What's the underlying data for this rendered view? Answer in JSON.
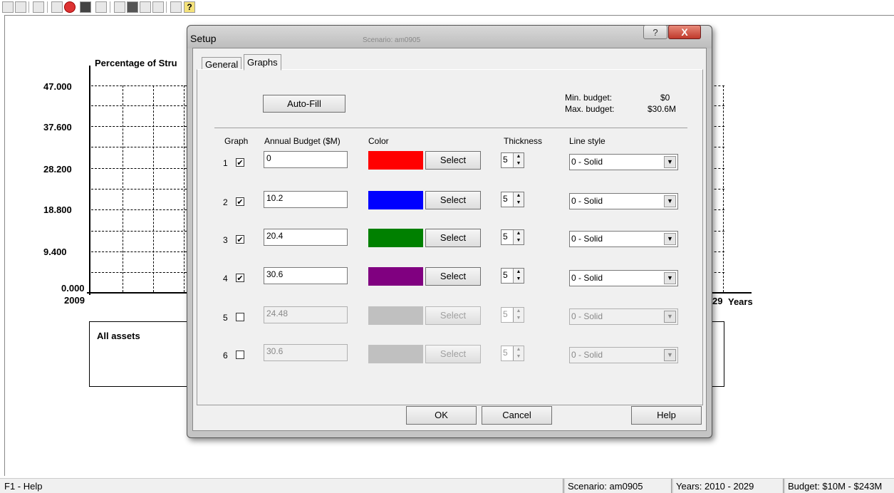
{
  "toolbar": {
    "icons": [
      "print-icon",
      "print-preview-icon",
      "export-icon",
      "open-icon",
      "close-red-icon",
      "save-icon",
      "print2-icon",
      "chart-icon",
      "fill-icon",
      "table-icon",
      "report-icon",
      "tools-icon",
      "help-icon"
    ]
  },
  "chart": {
    "title": "Percentage of Stru",
    "y_ticks": [
      "47.000",
      "37.600",
      "28.200",
      "18.800",
      "9.400",
      "0.000"
    ],
    "x_start": "2009",
    "x_end": "29",
    "x_axis_label": "Years",
    "legend_label": "All assets"
  },
  "dialog": {
    "title": "Setup",
    "bg_title": "Scenario: am0905",
    "help_glyph": "?",
    "close_glyph": "X",
    "tabs": [
      {
        "label": "General"
      },
      {
        "label": "Graphs"
      }
    ],
    "autofill_label": "Auto-Fill",
    "min_budget_label": "Min. budget:",
    "min_budget_value": "$0",
    "max_budget_label": "Max. budget:",
    "max_budget_value": "$30.6M",
    "col_graph": "Graph",
    "col_budget": "Annual Budget ($M)",
    "col_color": "Color",
    "col_thickness": "Thickness",
    "col_linestyle": "Line style",
    "rows": [
      {
        "num": "1",
        "checked": true,
        "budget": "0",
        "color": "#ff0000",
        "select": "Select",
        "thickness": "5",
        "style": "0 - Solid",
        "enabled": true
      },
      {
        "num": "2",
        "checked": true,
        "budget": "10.2",
        "color": "#0000ff",
        "select": "Select",
        "thickness": "5",
        "style": "0 - Solid",
        "enabled": true
      },
      {
        "num": "3",
        "checked": true,
        "budget": "20.4",
        "color": "#008000",
        "select": "Select",
        "thickness": "5",
        "style": "0 - Solid",
        "enabled": true
      },
      {
        "num": "4",
        "checked": true,
        "budget": "30.6",
        "color": "#800080",
        "select": "Select",
        "thickness": "5",
        "style": "0 - Solid",
        "enabled": true
      },
      {
        "num": "5",
        "checked": false,
        "budget": "24.48",
        "color": "#c0c0c0",
        "select": "Select",
        "thickness": "5",
        "style": "0 - Solid",
        "enabled": false
      },
      {
        "num": "6",
        "checked": false,
        "budget": "30.6",
        "color": "#c0c0c0",
        "select": "Select",
        "thickness": "5",
        "style": "0 - Solid",
        "enabled": false
      }
    ],
    "ok_label": "OK",
    "cancel_label": "Cancel",
    "help_label": "Help"
  },
  "status": {
    "help": "F1 - Help",
    "scenario": "Scenario: am0905",
    "years": "Years: 2010 - 2029",
    "budget": "Budget: $10M - $243M"
  }
}
